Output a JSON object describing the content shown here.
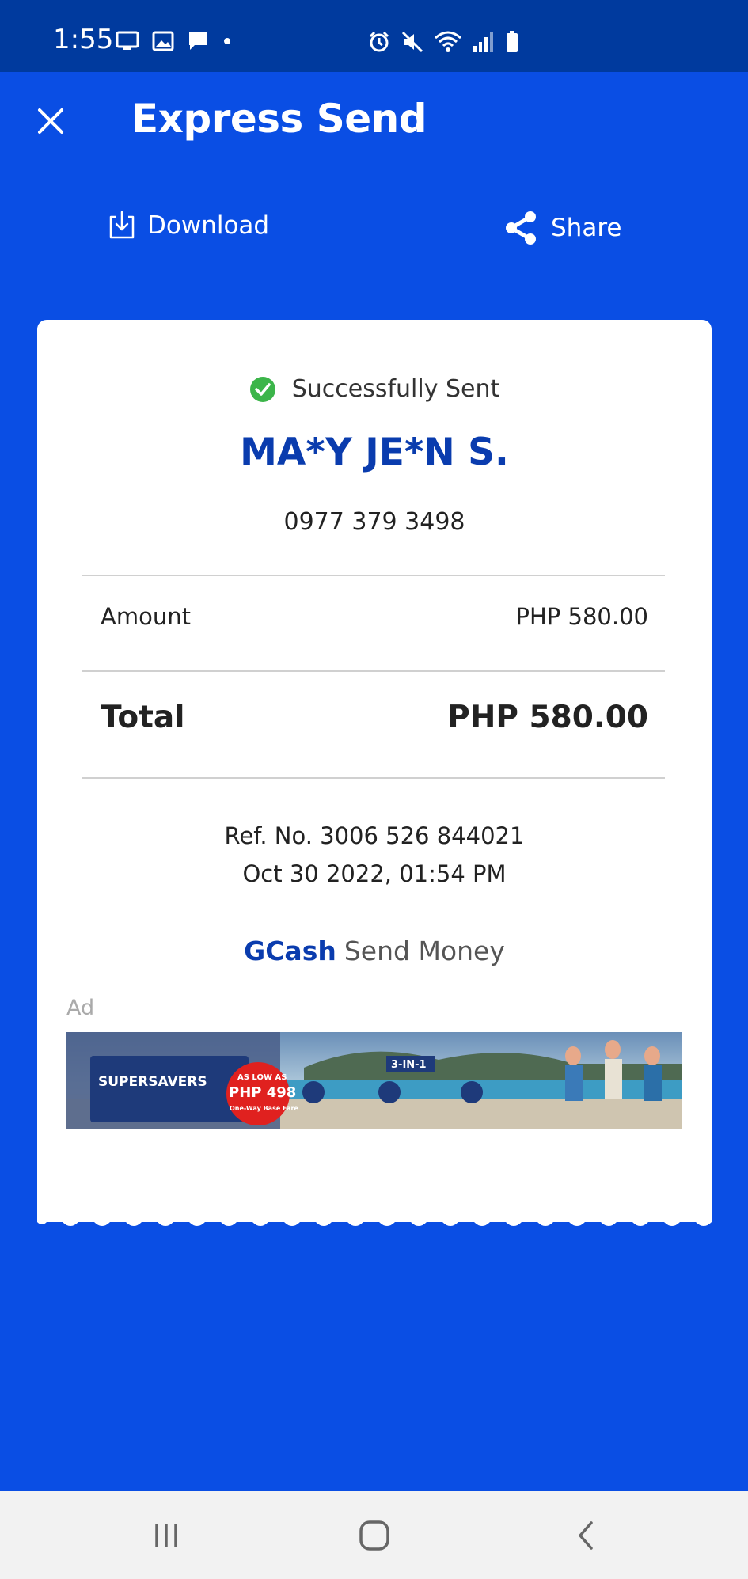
{
  "status_bar": {
    "time": "1:55"
  },
  "appbar": {
    "title": "Express Send",
    "close_icon": "close-icon"
  },
  "actions": {
    "download_label": "Download",
    "share_label": "Share"
  },
  "receipt": {
    "status_text": "Successfully Sent",
    "recipient_name": "MA*Y JE*N S.",
    "recipient_phone": "0977 379 3498",
    "amount_label": "Amount",
    "amount_value": "PHP 580.00",
    "total_label": "Total",
    "total_value": "PHP 580.00",
    "ref_no": "Ref. No. 3006 526 844021",
    "datetime": "Oct 30 2022, 01:54 PM",
    "brand_name": "GCash",
    "brand_service": "Send Money",
    "ad_label": "Ad",
    "ad": {
      "headline": "SUPERSAVERS",
      "promo_label": "AS LOW AS",
      "promo_price": "PHP 498",
      "promo_sub": "One-Way Base Fare",
      "badge": "3-IN-1"
    }
  },
  "colors": {
    "background": "#0a4ee4",
    "status_bar": "#003a9e",
    "brand_blue": "#0a3cae",
    "success_green": "#3cb54a"
  }
}
